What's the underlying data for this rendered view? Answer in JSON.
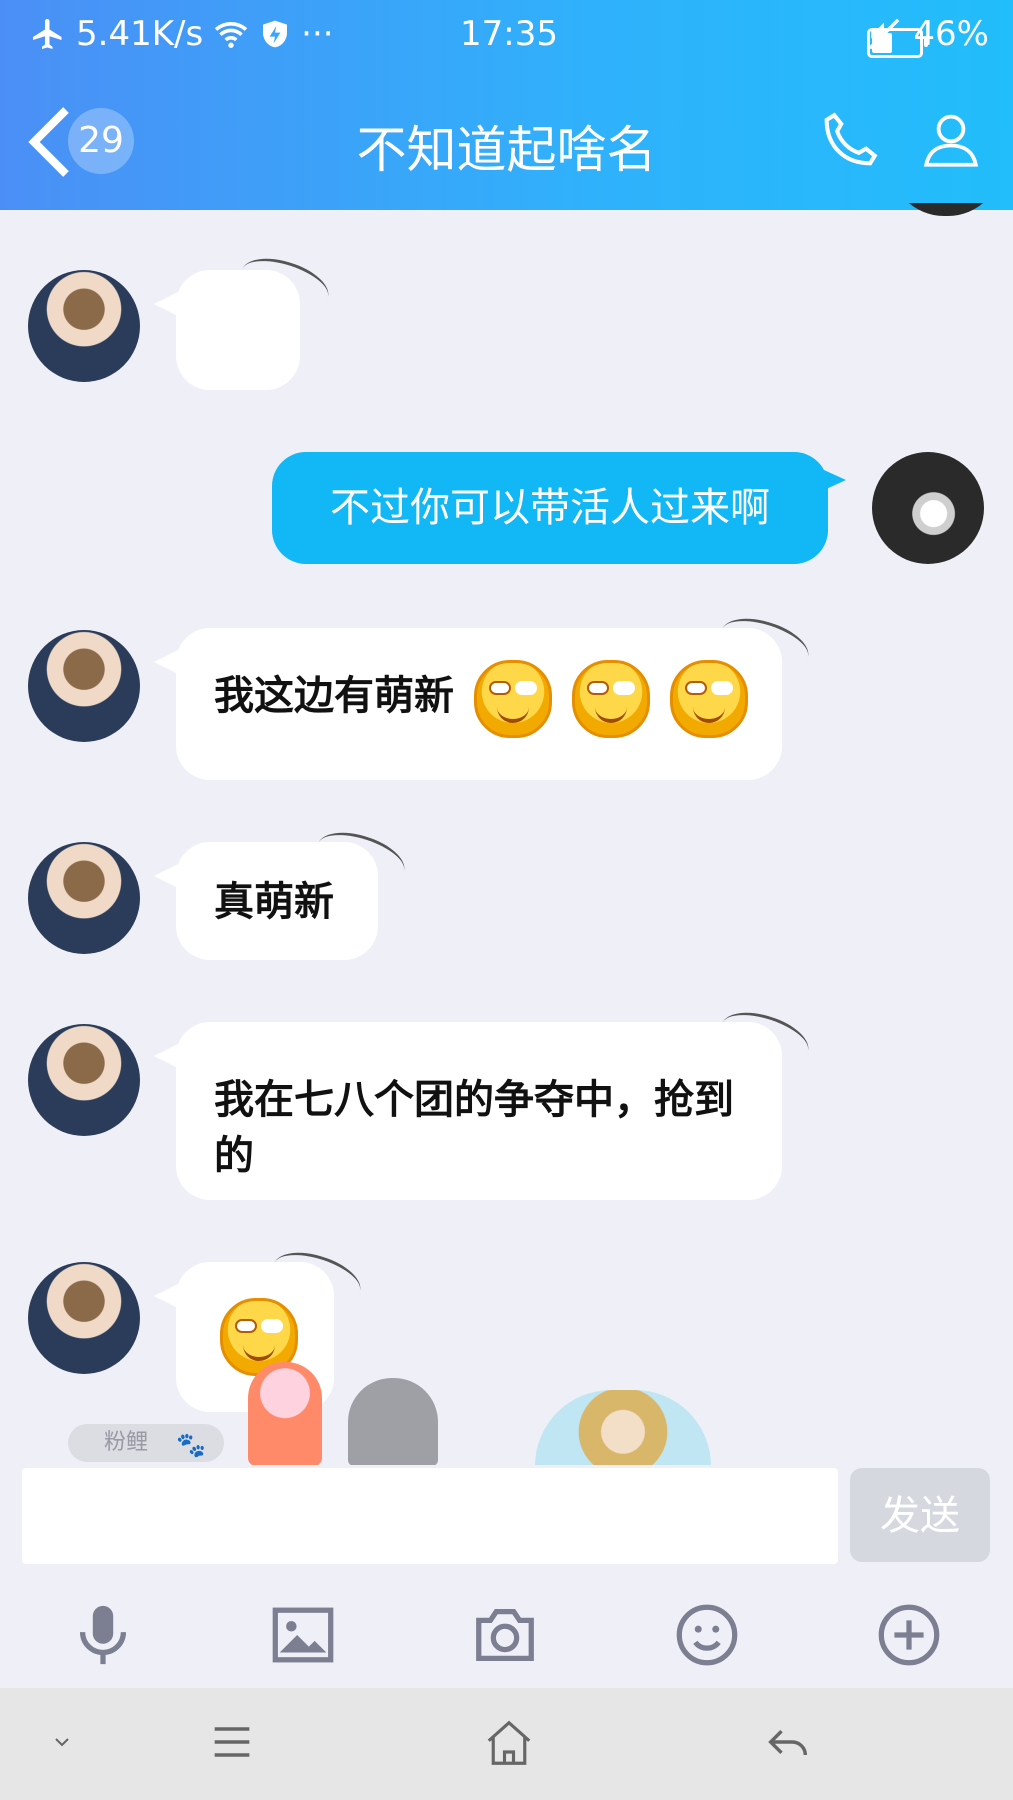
{
  "status_bar": {
    "network_speed": "5.41K/s",
    "more": "···",
    "time": "17:35",
    "battery_percent": "46%",
    "battery_level": 0.46
  },
  "header": {
    "back_count": "29",
    "title": "不知道起啥名"
  },
  "messages": [
    {
      "from": "other",
      "text": ""
    },
    {
      "from": "me",
      "text": "不过你可以带活人过来啊"
    },
    {
      "from": "other",
      "text": "我这边有萌新",
      "emoji_count": 3,
      "emoji": "smirk-emoji"
    },
    {
      "from": "other",
      "text": "真萌新"
    },
    {
      "from": "other",
      "text": "我在七八个团的争夺中，抢到的"
    },
    {
      "from": "other",
      "text": "",
      "emoji_count": 1,
      "emoji": "smirk-emoji"
    }
  ],
  "tag": {
    "label": "粉鲤"
  },
  "input": {
    "placeholder": ""
  },
  "send_label": "发送",
  "toolbar_icons": [
    "microphone-icon",
    "image-icon",
    "camera-icon",
    "emoji-icon",
    "plus-icon"
  ],
  "colors": {
    "header_start": "#4b8ff6",
    "header_end": "#22bdfb",
    "my_bubble": "#12b7f5",
    "background": "#eff0f7"
  }
}
